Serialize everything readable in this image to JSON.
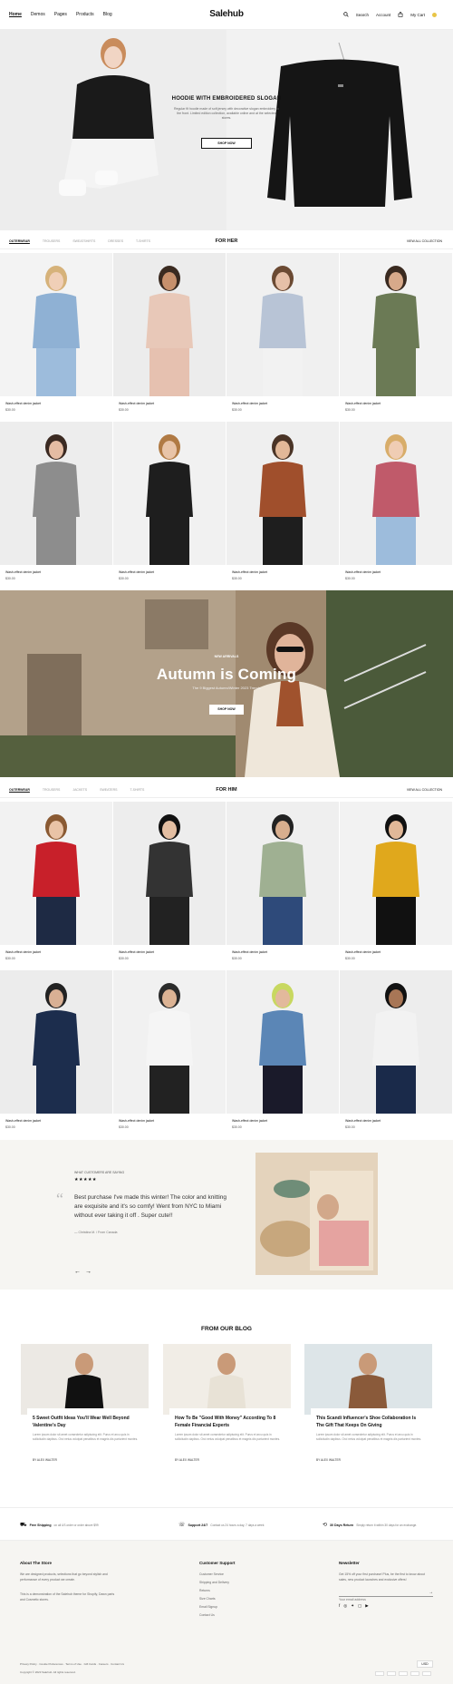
{
  "header": {
    "nav": [
      "Home",
      "Demos",
      "Pages",
      "Products",
      "Blog"
    ],
    "logo": "Salehub",
    "search": "Search",
    "account": "Account",
    "cart": "My Cart"
  },
  "hero": {
    "title": "HOODIE WITH EMBROIDERED SLOGAN",
    "text": "Regular fit hoodie made of soft jersey with decorative slogan embroidery to the front. Limited edition collection, available online and at the selected stores.",
    "button": "SHOP NOW"
  },
  "for_her": {
    "tabs": [
      "OUTERWEAR",
      "TROUSERS",
      "SWEATSHIRTS",
      "DRESSES",
      "T-SHIRTS"
    ],
    "title": "FOR HER",
    "view_all": "VIEW ALL COLLECTION",
    "products": [
      {
        "name": "Wash-effect denim jacket",
        "price": "$30.00"
      },
      {
        "name": "Wash-effect denim jacket",
        "price": "$30.00"
      },
      {
        "name": "Wash-effect denim jacket",
        "price": "$30.00"
      },
      {
        "name": "Wash-effect denim jacket",
        "price": "$30.00"
      },
      {
        "name": "Wash-effect denim jacket",
        "price": "$30.00"
      },
      {
        "name": "Wash-effect denim jacket",
        "price": "$30.00"
      },
      {
        "name": "Wash-effect denim jacket",
        "price": "$30.00"
      },
      {
        "name": "Wash-effect denim jacket",
        "price": "$30.00"
      }
    ]
  },
  "banner": {
    "kicker": "NEW ARRIVALS",
    "title": "Autumn is Coming",
    "subtitle": "The 9 Biggest Autumn/Winter 2023 Trends",
    "button": "SHOP NOW"
  },
  "for_him": {
    "tabs": [
      "OUTERWEAR",
      "TROUSERS",
      "JACKETS",
      "SWEATERS",
      "T-SHIRTS"
    ],
    "title": "FOR HIM",
    "view_all": "VIEW ALL COLLECTION",
    "products": [
      {
        "name": "Wash-effect denim jacket",
        "price": "$30.00"
      },
      {
        "name": "Wash-effect denim jacket",
        "price": "$30.00"
      },
      {
        "name": "Wash-effect denim jacket",
        "price": "$30.00"
      },
      {
        "name": "Wash-effect denim jacket",
        "price": "$30.00"
      },
      {
        "name": "Wash-effect denim jacket",
        "price": "$30.00"
      },
      {
        "name": "Wash-effect denim jacket",
        "price": "$30.00"
      },
      {
        "name": "Wash-effect denim jacket",
        "price": "$30.00"
      },
      {
        "name": "Wash-effect denim jacket",
        "price": "$30.00"
      }
    ]
  },
  "testimonial": {
    "label": "WHAT CUSTOMERS ARE SAYING",
    "quote": "Best purchase I've made this winter! The color and knitting are exquisite and it's so comfy! Went from NYC to Miami without ever taking it off . Super cute!!",
    "author": "— Christina M. / From Canada"
  },
  "blog": {
    "title": "FROM OUR BLOG",
    "posts": [
      {
        "title": "5 Sweet Outfit Ideas You'll Wear Well Beyond Valentine's Day",
        "excerpt": "Lorem ipsum dolor sit amet consectetur adipiscing elit. Purus et arcu quis in sollicitudin dapibus. Orci netus volutpat penatibus et magnis dis parturient montes.",
        "author": "BY ALEX WALTER"
      },
      {
        "title": "How To Be \"Good With Money\" According To 8 Female Financial Experts",
        "excerpt": "Lorem ipsum dolor sit amet consectetur adipiscing elit. Purus et arcu quis in sollicitudin dapibus. Orci netus volutpat penatibus et magnis dis parturient montes.",
        "author": "BY ALEX WALTER"
      },
      {
        "title": "This Scandi Influencer's Shoe Collaboration Is The Gift That Keeps On Giving",
        "excerpt": "Lorem ipsum dolor sit amet consectetur adipiscing elit. Purus et arcu quis in sollicitudin dapibus. Orci netus volutpat penatibus et magnis dis parturient montes.",
        "author": "BY ALEX WALTER"
      }
    ]
  },
  "features": [
    {
      "title": "Free Shipping",
      "text": "on all US order or order above $99"
    },
    {
      "title": "Support 24/7",
      "text": "Contact us 24 hours a day, 7 days a week"
    },
    {
      "title": "30 Days Return",
      "text": "Simply return it within 30 days for an exchange."
    }
  ],
  "footer": {
    "about_title": "About The Store",
    "about_text": "We are designed products, selections that go beyond stylish and performance of every product we create.",
    "about_text2": "This is a demonstration of the Salehub theme for Shopify, Dawn parts and Cosmetic stores.",
    "service_title": "Customer Support",
    "service_links": [
      "Customer Service",
      "Shipping and Delivery",
      "Returns",
      "Size Charts",
      "Email Signup",
      "Contact Us"
    ],
    "news_title": "Newsletter",
    "news_text": "Get 15% off your first purchase! Plus, be the first to know about sales, new product launches and exclusive offers!",
    "email_placeholder": "Your email address",
    "legal": "Privacy Policy · Cookie Preferences · Terms of Use · Gift Cards · Careers · Contact Us",
    "copyright": "Copyright © 2023 Salehub. All rights reserved.",
    "currency": "USD"
  }
}
